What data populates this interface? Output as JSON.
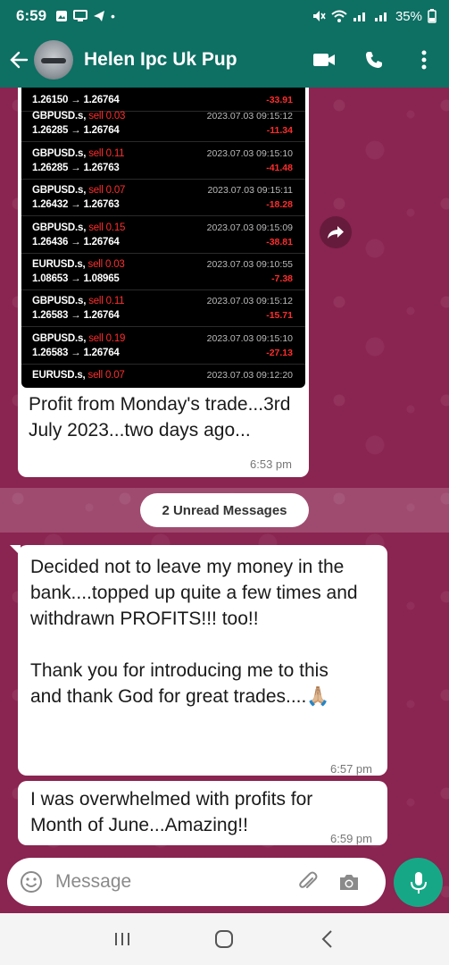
{
  "status_bar": {
    "time": "6:59",
    "battery": "35%"
  },
  "header": {
    "contact_name": "Helen Ipc Uk Pup"
  },
  "trades": [
    {
      "pair": "",
      "side": "",
      "prices": "1.26150 → 1.26764",
      "timestamp": "",
      "pnl": "-33.91"
    },
    {
      "pair": "GBPUSD.s,",
      "side": "sell 0.03",
      "prices": "1.26285 → 1.26764",
      "timestamp": "2023.07.03 09:15:12",
      "pnl": "-11.34"
    },
    {
      "pair": "GBPUSD.s,",
      "side": "sell 0.11",
      "prices": "1.26285 → 1.26763",
      "timestamp": "2023.07.03 09:15:10",
      "pnl": "-41.48"
    },
    {
      "pair": "GBPUSD.s,",
      "side": "sell 0.07",
      "prices": "1.26432 → 1.26763",
      "timestamp": "2023.07.03 09:15:11",
      "pnl": "-18.28"
    },
    {
      "pair": "GBPUSD.s,",
      "side": "sell 0.15",
      "prices": "1.26436 → 1.26764",
      "timestamp": "2023.07.03 09:15:09",
      "pnl": "-38.81"
    },
    {
      "pair": "EURUSD.s,",
      "side": "sell 0.03",
      "prices": "1.08653 → 1.08965",
      "timestamp": "2023.07.03 09:10:55",
      "pnl": "-7.38"
    },
    {
      "pair": "GBPUSD.s,",
      "side": "sell 0.11",
      "prices": "1.26583 → 1.26764",
      "timestamp": "2023.07.03 09:15:12",
      "pnl": "-15.71"
    },
    {
      "pair": "GBPUSD.s,",
      "side": "sell 0.19",
      "prices": "1.26583 → 1.26764",
      "timestamp": "2023.07.03 09:15:10",
      "pnl": "-27.13"
    },
    {
      "pair": "EURUSD.s,",
      "side": "sell 0.07",
      "prices": "",
      "timestamp": "2023.07.03 09:12:20",
      "pnl": ""
    }
  ],
  "messages": {
    "image_caption": "Profit from Monday's trade...3rd July 2023...two days ago...",
    "image_time": "6:53 pm",
    "unread_label": "2 Unread Messages",
    "msg1_para1": "Decided not to leave my money in the bank....topped up quite a few times and withdrawn PROFITS!!! too!!",
    "msg1_para2": "Thank you for introducing me to this and thank God for great trades....🙏🏼",
    "msg1_time": "6:57 pm",
    "msg2_text": "I was overwhelmed with profits for Month of June...Amazing!!",
    "msg2_time": "6:59 pm"
  },
  "composer": {
    "placeholder": "Message"
  }
}
